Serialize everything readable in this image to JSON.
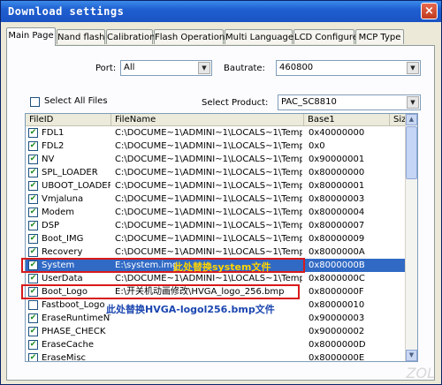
{
  "window": {
    "title": "Download settings",
    "close_label": "×"
  },
  "tabs": [
    {
      "label": "Main Page"
    },
    {
      "label": "Nand flash"
    },
    {
      "label": "Calibration"
    },
    {
      "label": "Flash Operations"
    },
    {
      "label": "Multi Languages"
    },
    {
      "label": "LCD Configure"
    },
    {
      "label": "MCP Type"
    }
  ],
  "port": {
    "label": "Port:",
    "value": "All"
  },
  "baudrate": {
    "label": "Bautrate:",
    "value": "460800"
  },
  "select_all": {
    "label": "Select All Files",
    "checked": false
  },
  "product": {
    "label": "Select Product:",
    "value": "PAC_SC8810"
  },
  "columns": [
    "FileID",
    "FileName",
    "Base1",
    "Size"
  ],
  "rows": [
    {
      "id": "FDL1",
      "name": "C:\\DOCUME~1\\ADMINI~1\\LOCALS~1\\Temp\\...",
      "base": "0x40000000",
      "checked": true
    },
    {
      "id": "FDL2",
      "name": "C:\\DOCUME~1\\ADMINI~1\\LOCALS~1\\Temp\\...",
      "base": "0x0",
      "checked": true
    },
    {
      "id": "NV",
      "name": "C:\\DOCUME~1\\ADMINI~1\\LOCALS~1\\Temp\\...",
      "base": "0x90000001",
      "checked": true
    },
    {
      "id": "SPL_LOADER",
      "name": "C:\\DOCUME~1\\ADMINI~1\\LOCALS~1\\Temp\\...",
      "base": "0x80000000",
      "checked": true
    },
    {
      "id": "UBOOT_LOADER",
      "name": "C:\\DOCUME~1\\ADMINI~1\\LOCALS~1\\Temp\\...",
      "base": "0x80000001",
      "checked": true
    },
    {
      "id": "Vmjaluna",
      "name": "C:\\DOCUME~1\\ADMINI~1\\LOCALS~1\\Temp\\...",
      "base": "0x80000003",
      "checked": true
    },
    {
      "id": "Modem",
      "name": "C:\\DOCUME~1\\ADMINI~1\\LOCALS~1\\Temp\\...",
      "base": "0x80000004",
      "checked": true
    },
    {
      "id": "DSP",
      "name": "C:\\DOCUME~1\\ADMINI~1\\LOCALS~1\\Temp\\...",
      "base": "0x80000007",
      "checked": true
    },
    {
      "id": "Boot_IMG",
      "name": "C:\\DOCUME~1\\ADMINI~1\\LOCALS~1\\Temp\\...",
      "base": "0x80000009",
      "checked": true
    },
    {
      "id": "Recovery",
      "name": "C:\\DOCUME~1\\ADMINI~1\\LOCALS~1\\Temp\\...",
      "base": "0x8000000A",
      "checked": true
    },
    {
      "id": "System",
      "name": "E:\\system.img",
      "base": "0x8000000B",
      "checked": true,
      "selected": true
    },
    {
      "id": "UserData",
      "name": "C:\\DOCUME~1\\ADMINI~1\\LOCALS~1\\Temp\\...",
      "base": "0x8000000C",
      "checked": true
    },
    {
      "id": "Boot_Logo",
      "name": "E:\\开关机动画修改\\HVGA_logo_256.bmp",
      "base": "0x8000000F",
      "checked": true
    },
    {
      "id": "Fastboot_Logo",
      "name": "",
      "base": "0x80000010",
      "checked": false
    },
    {
      "id": "EraseRuntimeNV",
      "name": "",
      "base": "0x90000003",
      "checked": true
    },
    {
      "id": "PHASE_CHECK",
      "name": "",
      "base": "0x90000002",
      "checked": true
    },
    {
      "id": "EraseCache",
      "name": "",
      "base": "0x8000000D",
      "checked": true
    },
    {
      "id": "EraseMisc",
      "name": "",
      "base": "0x8000000E",
      "checked": true
    }
  ],
  "annotations": {
    "system": "此处替换system文件",
    "bootlogo": "此处替换HVGA-logol256.bmp文件"
  },
  "watermark": "ZOL",
  "colors": {
    "titlebar": "#1f5fd0",
    "selected_row": "#316ac5",
    "annotation_box": "#d81a1a",
    "annotation_text": "#ffd400"
  }
}
